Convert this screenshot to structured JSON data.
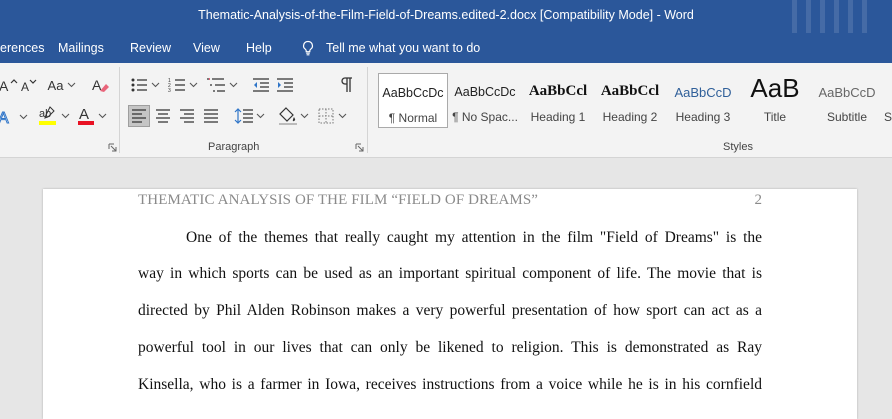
{
  "window": {
    "title": "Thematic-Analysis-of-the-Film-Field-of-Dreams.edited-2.docx [Compatibility Mode]  -  Word"
  },
  "menu": {
    "tabs": [
      "erences",
      "Mailings",
      "Review",
      "View",
      "Help"
    ],
    "tell_me": "Tell me what you want to do"
  },
  "ribbon": {
    "font_group": {
      "change_case_label": "Aa"
    },
    "paragraph_group": {
      "label": "Paragraph"
    },
    "styles_group": {
      "label": "Styles",
      "styles": [
        {
          "preview": "AaBbCcDc",
          "name": "¶ Normal"
        },
        {
          "preview": "AaBbCcDc",
          "name": "¶ No Spac..."
        },
        {
          "preview": "AaBbCcl",
          "name": "Heading 1"
        },
        {
          "preview": "AaBbCcl",
          "name": "Heading 2"
        },
        {
          "preview": "AaBbCcD",
          "name": "Heading 3"
        },
        {
          "preview": "AaB",
          "name": "Title"
        },
        {
          "preview": "AaBbCcD",
          "name": "Subtitle"
        },
        {
          "preview": "",
          "name": "S"
        }
      ]
    }
  },
  "document": {
    "header_text": "THEMATIC ANALYSIS OF THE FILM “FIELD OF DREAMS”",
    "page_number": "2",
    "lines": [
      "One of the themes that really caught my attention in the film \"Field of Dreams\" is the",
      "way in which sports can be used as an important spiritual component of life. The movie that is",
      "directed by Phil Alden Robinson makes a very powerful presentation of how sport can act as a",
      "powerful tool in our lives that can only be likened to religion. This is demonstrated as Ray",
      "Kinsella, who is a farmer in Iowa, receives instructions from a voice while he is in his cornfield"
    ]
  },
  "colors": {
    "title_bar": "#2b579a",
    "ribbon": "#f3f3f3",
    "canvas": "#e6e6e6",
    "font_color_red": "#e81123",
    "highlight_yellow": "#ffff00"
  }
}
